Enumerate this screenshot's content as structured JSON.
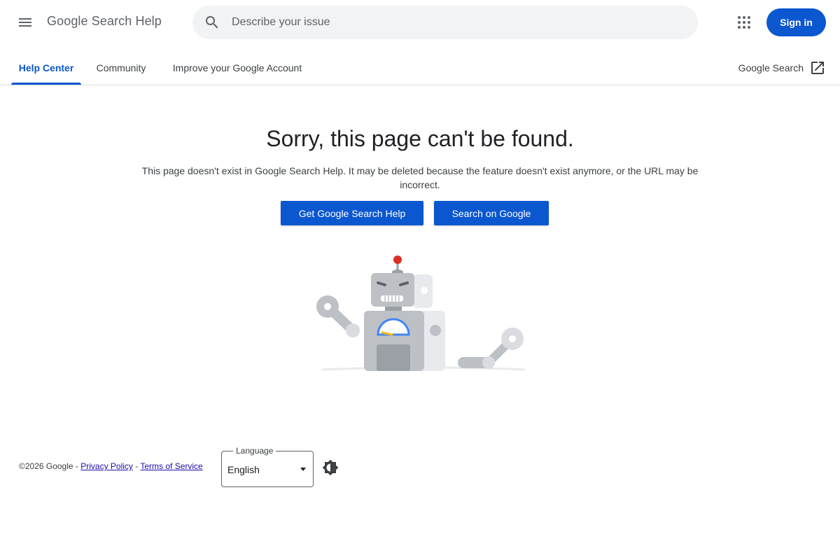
{
  "header": {
    "menu_icon": "menu-icon",
    "title": "Google Search Help",
    "search": {
      "placeholder": "Describe your issue",
      "value": "",
      "icon": "search-icon"
    },
    "apps_icon": "apps-grid-icon",
    "signin_label": "Sign in"
  },
  "tabs": [
    {
      "label": "Help Center",
      "active": true
    },
    {
      "label": "Community",
      "active": false
    },
    {
      "label": "Improve your Google Account",
      "active": false
    }
  ],
  "external_link": {
    "label": "Google Search",
    "icon": "open-in-new-icon"
  },
  "main": {
    "title": "Sorry, this page can't be found.",
    "description": "This page doesn't exist in Google Search Help. It may be deleted because the feature doesn't exist anymore, or the URL may be incorrect.",
    "buttons": [
      {
        "label": "Get Google Search Help"
      },
      {
        "label": "Search on Google"
      }
    ]
  },
  "footer": {
    "copyright": "©2026 Google - ",
    "privacy": "Privacy Policy",
    "separator": " - ",
    "terms": "Terms of Service",
    "language_label": "Language",
    "language_value": "English",
    "theme_icon": "brightness-icon"
  },
  "colors": {
    "accent": "#0b57d0",
    "robot_red": "#d93025",
    "robot_blue": "#4285f4",
    "robot_yellow": "#fbbc04"
  }
}
